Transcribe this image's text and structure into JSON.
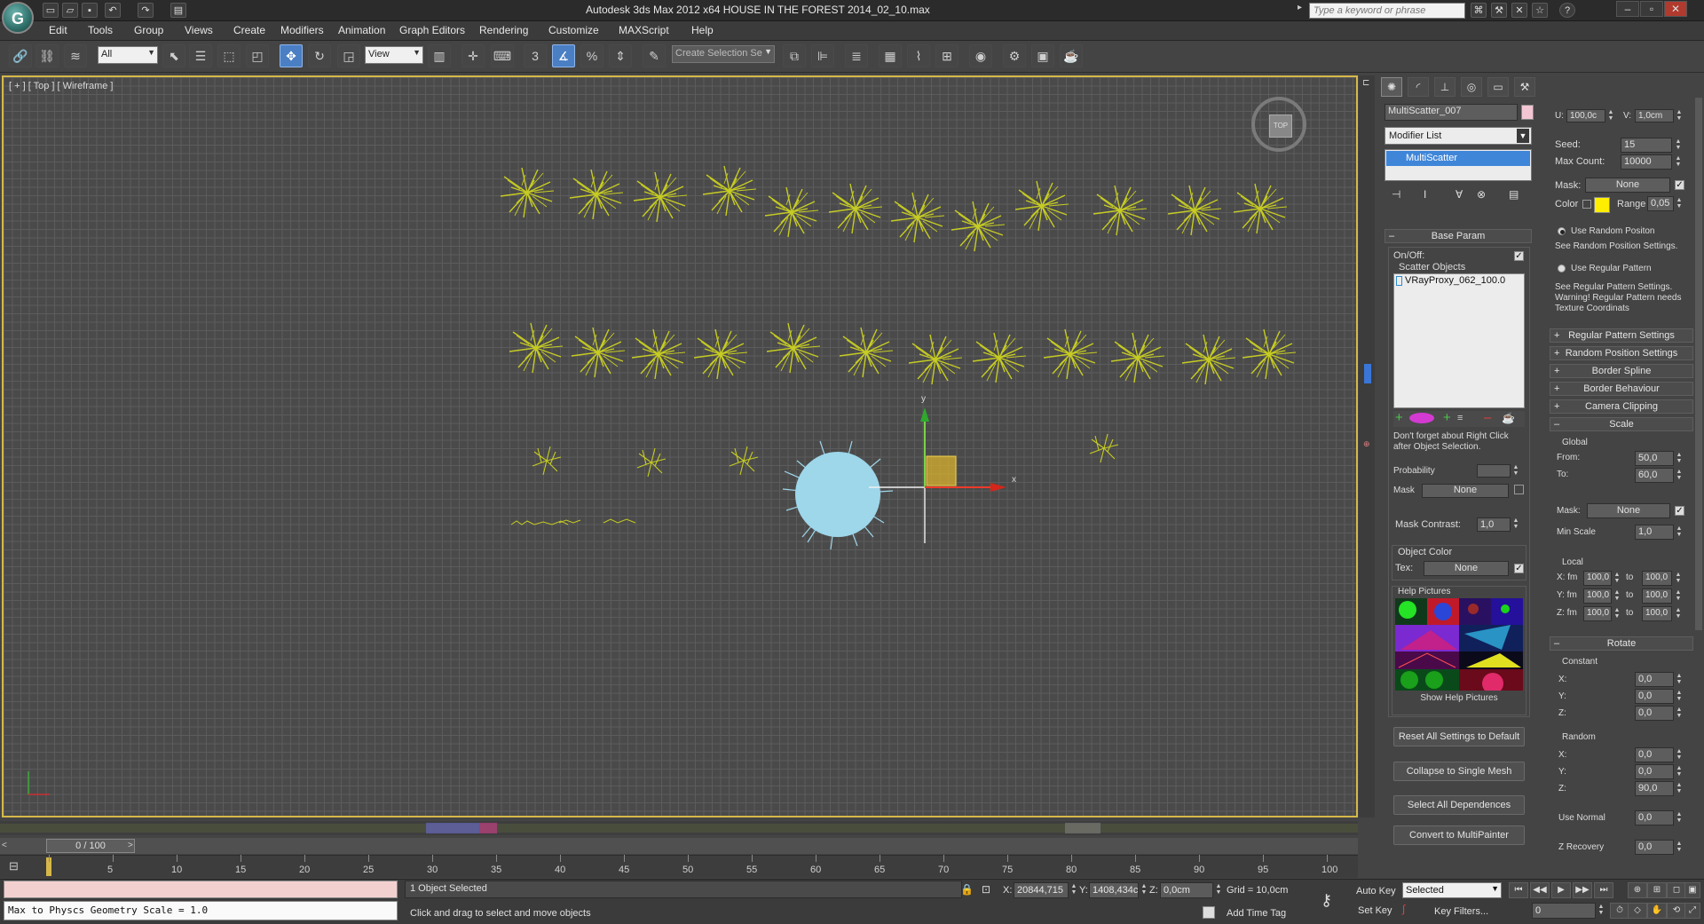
{
  "app": {
    "title": "Autodesk 3ds Max  2012 x64      HOUSE IN THE FOREST 2014_02_10.max",
    "search_placeholder": "Type a keyword or phrase"
  },
  "menu": [
    "Edit",
    "Tools",
    "Group",
    "Views",
    "Create",
    "Modifiers",
    "Animation",
    "Graph Editors",
    "Rendering",
    "Customize",
    "MAXScript",
    "Help"
  ],
  "toolbar": {
    "selection_filter": "All",
    "reference_coord": "View",
    "named_selection_placeholder": "Create Selection Se",
    "snap_label": "3"
  },
  "viewport": {
    "label": "[ + ] [ Top ] [ Wireframe ]",
    "viewcube_label": "TOP",
    "axis_x": "x",
    "axis_y": "y"
  },
  "command_panel": {
    "object_name": "MultiScatter_007",
    "object_color": "#f4c6d3",
    "modifier_list": "Modifier List",
    "stack_item": "MultiScatter",
    "base_param": {
      "title": "Base Param",
      "onoff_label": "On/Off:",
      "scatter_objects_label": "Scatter Objects",
      "scatter_item": "VRayProxy_062_100.0",
      "note": "Don't forget about Right Click after Object Selection.",
      "probability_label": "Probability",
      "mask_label": "Mask",
      "mask_value": "None",
      "mask_contrast_label": "Mask Contrast:",
      "mask_contrast_value": "1,0",
      "object_color_label": "Object Color",
      "tex_label": "Tex:",
      "tex_value": "None",
      "help_pictures_label": "Help Pictures",
      "show_help": "Show Help Pictures",
      "buttons": [
        "Reset All Settings to Default",
        "Collapse to Single Mesh",
        "Select All Dependences",
        "Convert to MultiPainter"
      ]
    }
  },
  "rollout_panel": {
    "u_label": "U:",
    "u_value": "100,0c",
    "v_label": "V:",
    "v_value": "1,0cm",
    "seed_label": "Seed:",
    "seed_value": "15",
    "max_count_label": "Max Count:",
    "max_count_value": "10000",
    "mask_label": "Mask:",
    "mask_value": "None",
    "color_label": "Color",
    "color_swatch": "#ffee00",
    "range_label": "Range",
    "range_value": "0,05",
    "use_random_position": "Use Random Positon",
    "random_position_note": "See Random Position Settings.",
    "use_regular_pattern": "Use Regular Pattern",
    "regular_pattern_note": "See Regular Pattern Settings. Warning! Regular Pattern needs Texture Coordinats",
    "rollouts": [
      "Regular Pattern Settings",
      "Random Position Settings",
      "Border Spline",
      "Border Behaviour",
      "Camera Clipping"
    ],
    "scale": {
      "title": "Scale",
      "global_label": "Global",
      "from_label": "From:",
      "from_value": "50,0",
      "to_label": "To:",
      "to_value": "60,0",
      "mask_label": "Mask:",
      "mask_value": "None",
      "min_scale_label": "Min Scale",
      "min_scale_value": "1,0",
      "local_label": "Local",
      "rows": [
        {
          "label": "X: fm",
          "from": "100,0",
          "to_label": "to",
          "to": "100,0"
        },
        {
          "label": "Y: fm",
          "from": "100,0",
          "to_label": "to",
          "to": "100,0"
        },
        {
          "label": "Z: fm",
          "from": "100,0",
          "to_label": "to",
          "to": "100,0"
        }
      ]
    },
    "rotate": {
      "title": "Rotate",
      "constant_label": "Constant",
      "constant": [
        {
          "label": "X:",
          "value": "0,0"
        },
        {
          "label": "Y:",
          "value": "0,0"
        },
        {
          "label": "Z:",
          "value": "0,0"
        }
      ],
      "random_label": "Random",
      "random": [
        {
          "label": "X:",
          "value": "0,0"
        },
        {
          "label": "Y:",
          "value": "0,0"
        },
        {
          "label": "Z:",
          "value": "90,0"
        }
      ],
      "use_normal_label": "Use Normal",
      "use_normal_value": "0,0",
      "z_recovery_label": "Z Recovery",
      "z_recovery_value": "0,0"
    }
  },
  "timeline": {
    "frame_display": "0 / 100",
    "ticks": [
      "0",
      "5",
      "10",
      "15",
      "20",
      "25",
      "30",
      "35",
      "40",
      "45",
      "50",
      "55",
      "60",
      "65",
      "70",
      "75",
      "80",
      "85",
      "90",
      "95",
      "100"
    ]
  },
  "status": {
    "listener_text": "Max to Physcs Geometry Scale = 1.0",
    "selection_info": "1 Object Selected",
    "prompt": "Click and drag to select and move objects",
    "x_label": "X:",
    "x_value": "20844,715",
    "y_label": "Y:",
    "y_value": "1408,434c",
    "z_label": "Z:",
    "z_value": "0,0cm",
    "grid": "Grid = 10,0cm",
    "add_time_tag": "Add Time Tag",
    "auto_key": "Auto Key",
    "set_key": "Set Key",
    "key_mode": "Selected",
    "key_filters": "Key Filters...",
    "current_frame": "0"
  }
}
